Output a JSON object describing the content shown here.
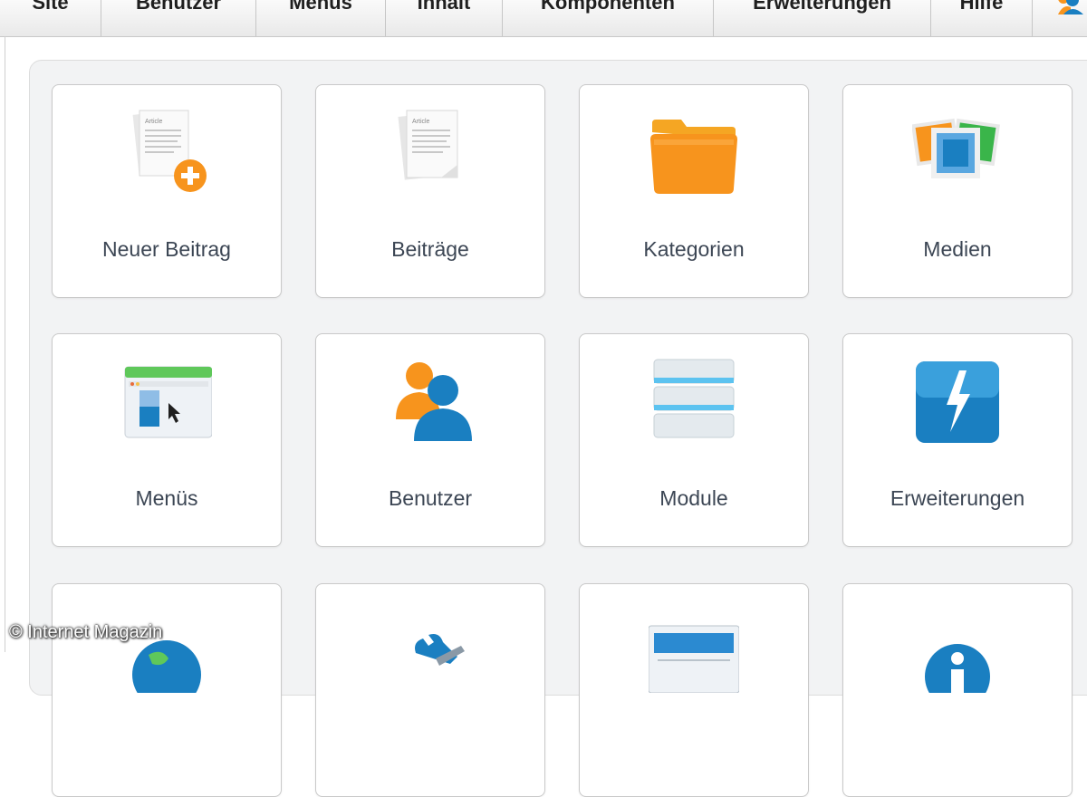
{
  "menubar": {
    "items": [
      {
        "label": "Site"
      },
      {
        "label": "Benutzer"
      },
      {
        "label": "Menüs"
      },
      {
        "label": "Inhalt"
      },
      {
        "label": "Komponenten"
      },
      {
        "label": "Erweiterungen"
      },
      {
        "label": "Hilfe"
      }
    ],
    "user_icon": "user-icon"
  },
  "tiles": {
    "row1": [
      {
        "label": "Neuer Beitrag",
        "icon": "new-article-icon"
      },
      {
        "label": "Beiträge",
        "icon": "articles-icon"
      },
      {
        "label": "Kategorien",
        "icon": "folder-icon"
      },
      {
        "label": "Medien",
        "icon": "media-icon"
      }
    ],
    "row2": [
      {
        "label": "Menüs",
        "icon": "menu-icon"
      },
      {
        "label": "Benutzer",
        "icon": "users-icon"
      },
      {
        "label": "Module",
        "icon": "modules-icon"
      },
      {
        "label": "Erweiterungen",
        "icon": "extensions-icon"
      }
    ],
    "row3": [
      {
        "label": "",
        "icon": "globe-icon"
      },
      {
        "label": "",
        "icon": "tools-icon"
      },
      {
        "label": "",
        "icon": "template-icon"
      },
      {
        "label": "",
        "icon": "info-icon"
      }
    ]
  },
  "watermark": "© Internet Magazin",
  "colors": {
    "accent_orange": "#f7941d",
    "accent_blue": "#1a7fc1",
    "label_text": "#3c4654"
  }
}
